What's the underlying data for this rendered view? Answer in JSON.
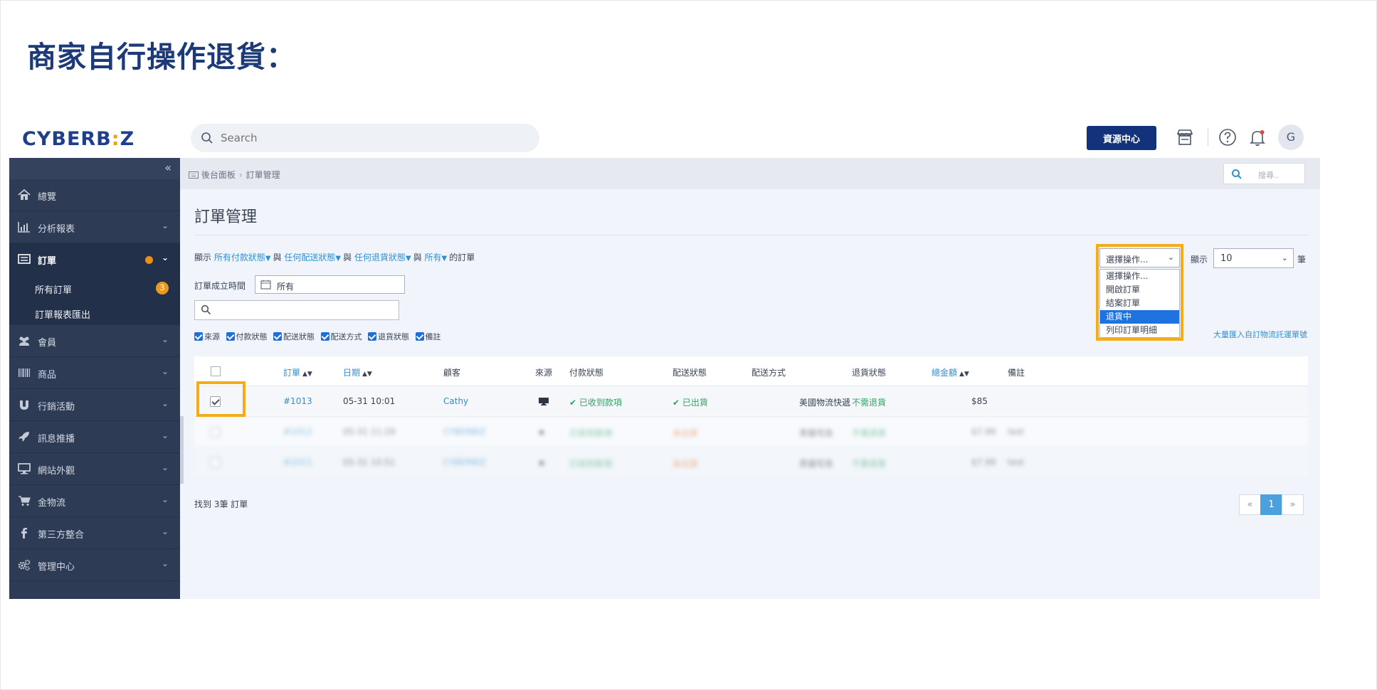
{
  "slide": {
    "title": "商家自行操作退貨："
  },
  "header": {
    "logo_text": "CYBERB",
    "logo_colon": ":",
    "logo_suffix": "Z",
    "search_placeholder": "Search",
    "resource_button": "資源中心",
    "avatar_initial": "G"
  },
  "sidebar": {
    "collapse": "«",
    "items": [
      {
        "label": "總覽",
        "icon": "home-icon"
      },
      {
        "label": "分析報表",
        "icon": "bar-chart-icon"
      },
      {
        "label": "訂單",
        "icon": "list-icon"
      },
      {
        "label": "會員",
        "icon": "users-icon"
      },
      {
        "label": "商品",
        "icon": "barcode-icon"
      },
      {
        "label": "行銷活動",
        "icon": "magnet-icon"
      },
      {
        "label": "訊息推播",
        "icon": "rocket-icon"
      },
      {
        "label": "網站外觀",
        "icon": "monitor-icon"
      },
      {
        "label": "金物流",
        "icon": "cart-icon"
      },
      {
        "label": "第三方整合",
        "icon": "facebook-icon"
      },
      {
        "label": "管理中心",
        "icon": "gears-icon"
      }
    ],
    "sub_items": [
      {
        "label": "所有訂單",
        "badge": "3"
      },
      {
        "label": "訂單報表匯出"
      }
    ],
    "accent": "#e88e19"
  },
  "breadcrumb": {
    "home": "後台面板",
    "current": "訂單管理"
  },
  "top_search_placeholder": "搜尋..",
  "page": {
    "title": "訂單管理"
  },
  "filters": {
    "prefix": "顯示",
    "payment": "所有付款狀態",
    "and1": "與",
    "shipping": "任何配送狀態",
    "and2": "與",
    "returns": "任何退貨狀態",
    "and3": "與",
    "all": "所有",
    "suffix": "的訂單",
    "date_label": "訂單成立時間",
    "date_value": "所有"
  },
  "columns_toggle": [
    "來源",
    "付款狀態",
    "配送狀態",
    "配送方式",
    "退貨狀態",
    "備註"
  ],
  "bulk_link": "大量匯入自訂物流託運單號",
  "action_dropdown": {
    "selected": "選擇操作...",
    "options": [
      "選擇操作...",
      "開啟訂單",
      "結案訂單",
      "退貨中",
      "列印訂單明細"
    ],
    "highlighted_index": 3
  },
  "page_size": {
    "label": "顯示",
    "value": "10",
    "unit": "筆"
  },
  "table": {
    "headers": {
      "order": "訂單",
      "date": "日期",
      "customer": "顧客",
      "source": "來源",
      "payment": "付款狀態",
      "shipping": "配送狀態",
      "method": "配送方式",
      "returns": "退貨狀態",
      "total": "總金額",
      "note": "備註"
    },
    "rows": [
      {
        "order": "#1013",
        "date": "05-31 10:01",
        "customer": "Cathy",
        "payment": "已收到款項",
        "shipping": "已出貨",
        "method": "美國物流快遞",
        "returns": "不需退貨",
        "total": "$85",
        "note": ""
      },
      {
        "order": "#1012",
        "date": "05-31 11:29",
        "customer": "CYBERBIZ",
        "payment": "已收到款項",
        "shipping": "未出貨",
        "method": "黑貓宅急",
        "returns": "不需退貨",
        "total": "$7.99",
        "note": "test"
      },
      {
        "order": "#1011",
        "date": "05-31 10:51",
        "customer": "CYBERBIZ",
        "payment": "已收到款項",
        "shipping": "未出貨",
        "method": "黑貓宅急",
        "returns": "不需退貨",
        "total": "$7.99",
        "note": "test"
      }
    ]
  },
  "footer": {
    "found": "找到 3筆 訂單",
    "prev": "«",
    "page": "1",
    "next": "»"
  },
  "colors": {
    "highlight": "#f2ad19",
    "link": "#2f8fd2",
    "primary": "#13327c"
  }
}
